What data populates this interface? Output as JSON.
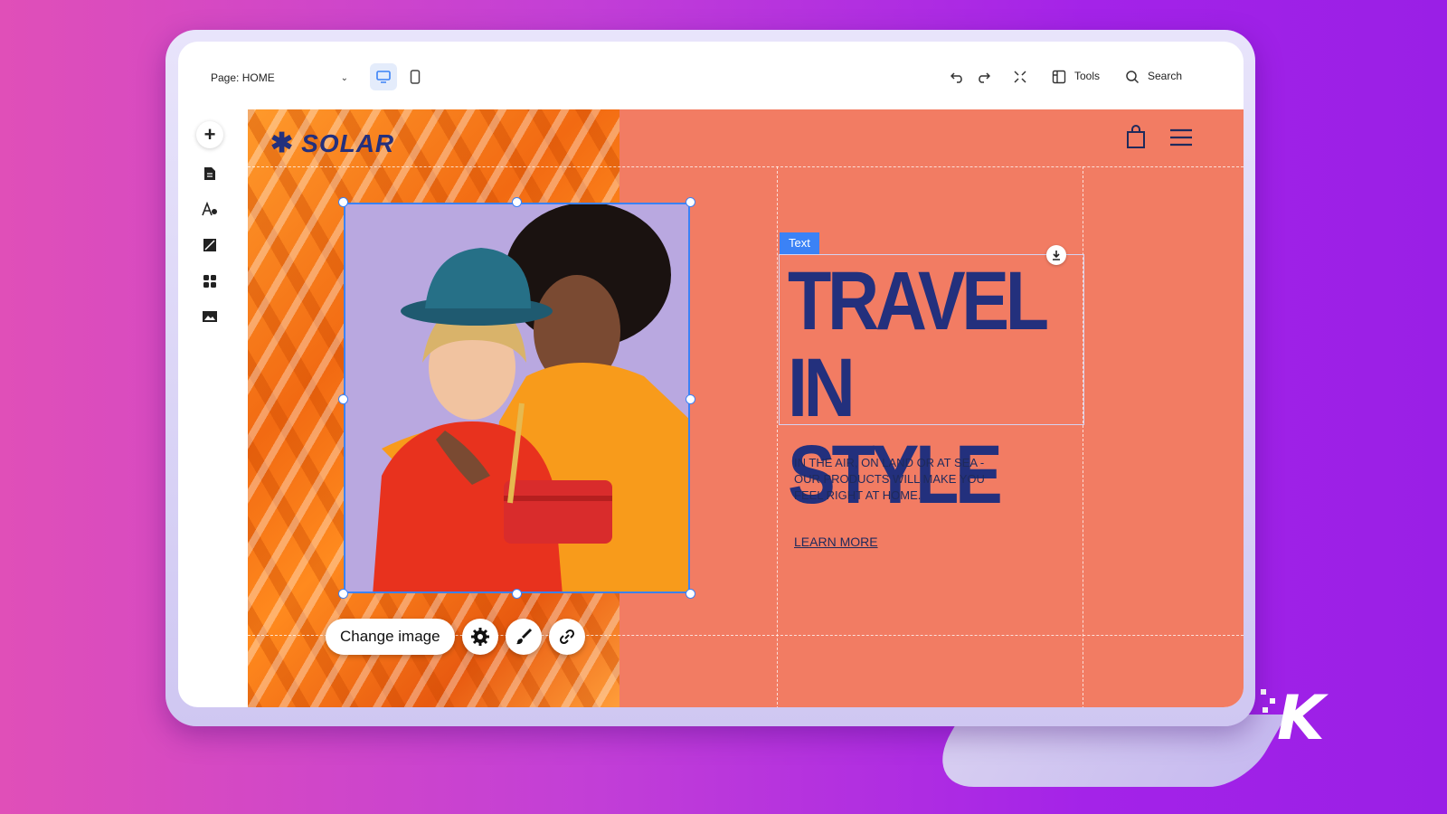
{
  "editor": {
    "page_select": {
      "label": "Page: HOME"
    },
    "toolbar": {
      "tools_label": "Tools",
      "search_label": "Search"
    }
  },
  "site": {
    "logo_text": "SOLAR",
    "text_tag": "Text",
    "headline": [
      "TRAVEL",
      "IN STYLE"
    ],
    "body": "IN THE AIR, ON LAND OR AT SEA - OUR PRODUCTS WILL MAKE YOU FEEL RIGHT AT HOME.",
    "cta": "LEARN MORE"
  },
  "image_toolbar": {
    "change_label": "Change image"
  },
  "watermark": "K",
  "colors": {
    "canvas_bg": "#f27c63",
    "brand_navy": "#23307d",
    "selection_blue": "#3b82f6"
  },
  "icons": [
    "chevron-down-icon",
    "desktop-icon",
    "mobile-icon",
    "undo-icon",
    "redo-icon",
    "fit-screen-icon",
    "tools-icon",
    "search-icon",
    "add-icon",
    "pages-icon",
    "theme-icon",
    "background-icon",
    "apps-icon",
    "media-icon",
    "bag-icon",
    "menu-icon",
    "download-icon",
    "gear-icon",
    "brush-icon",
    "link-icon"
  ]
}
